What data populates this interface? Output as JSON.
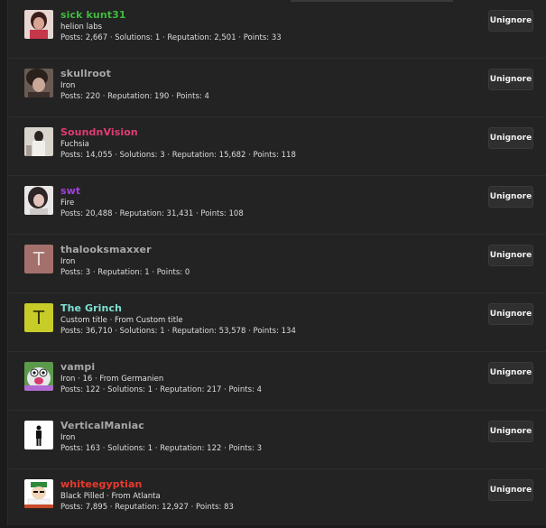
{
  "ignored_members": [
    {
      "username": "sick kunt31",
      "name_color": "#3dbb3d",
      "title": "helion labs",
      "stats": "Posts: 2,667 · Solutions: 1 · Reputation: 2,501 · Points: 33",
      "avatar": "photo"
    },
    {
      "username": "skullroot",
      "name_color": "#a8a8a8",
      "title": "Iron",
      "stats": "Posts: 220 · Reputation: 190 · Points: 4",
      "avatar": "photo"
    },
    {
      "username": "SoundnVision",
      "name_color": "#e23c72",
      "title": "Fuchsia",
      "stats": "Posts: 14,055 · Solutions: 3 · Reputation: 15,682 · Points: 118",
      "avatar": "photo"
    },
    {
      "username": "swt",
      "name_color": "#a23ee0",
      "title": "Fire",
      "stats": "Posts: 20,488 · Reputation: 31,431 · Points: 108",
      "avatar": "photo"
    },
    {
      "username": "thalooksmaxxer",
      "name_color": "#a8a8a8",
      "title": "Iron",
      "stats": "Posts: 3 · Reputation: 1 · Points: 0",
      "avatar": "letter",
      "avatar_letter": "T",
      "avatar_bg": "#a4706c",
      "avatar_fg": "#e9d9d7"
    },
    {
      "username": "The Grinch",
      "name_color": "#7fe0d2",
      "title": "Custom title · From Custom title",
      "stats": "Posts: 36,710 · Solutions: 1 · Reputation: 53,578 · Points: 134",
      "avatar": "letter",
      "avatar_letter": "T",
      "avatar_bg": "#c8cc28",
      "avatar_fg": "#34360a"
    },
    {
      "username": "vampi",
      "name_color": "#a8a8a8",
      "title": "Iron · 16 · From Germanien",
      "stats": "Posts: 122 · Solutions: 1 · Reputation: 217 · Points: 4",
      "avatar": "photo"
    },
    {
      "username": "VerticalManiac",
      "name_color": "#a8a8a8",
      "title": "Iron",
      "stats": "Posts: 163 · Solutions: 1 · Reputation: 122 · Points: 3",
      "avatar": "photo"
    },
    {
      "username": "whiteegyptian",
      "name_color": "#e83a2e",
      "title": "Black Pilled · From Atlanta",
      "stats": "Posts: 7,895 · Reputation: 12,927 · Points: 83",
      "avatar": "photo"
    }
  ],
  "unignore_label": "Unignore"
}
